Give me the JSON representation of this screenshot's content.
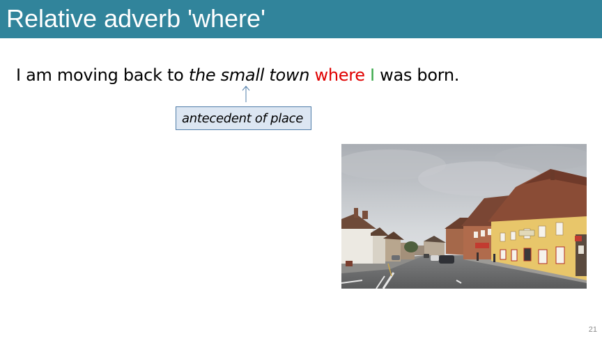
{
  "slide": {
    "title": "Relative adverb 'where'",
    "sentence": {
      "part1": "I am moving back to ",
      "antecedent": "the small town",
      "space1": " ",
      "relative_adverb": "where",
      "space2": " ",
      "subject": "I",
      "part2": " was born."
    },
    "label": "antecedent of place",
    "page_number": "21",
    "colors": {
      "title_bar": "#31849b",
      "relative_adverb": "#e00000",
      "subject": "#3aa84a",
      "label_box_fill": "#dce6f2",
      "label_box_border": "#4f7ca8"
    },
    "photo_icon": "town-street-photo"
  }
}
